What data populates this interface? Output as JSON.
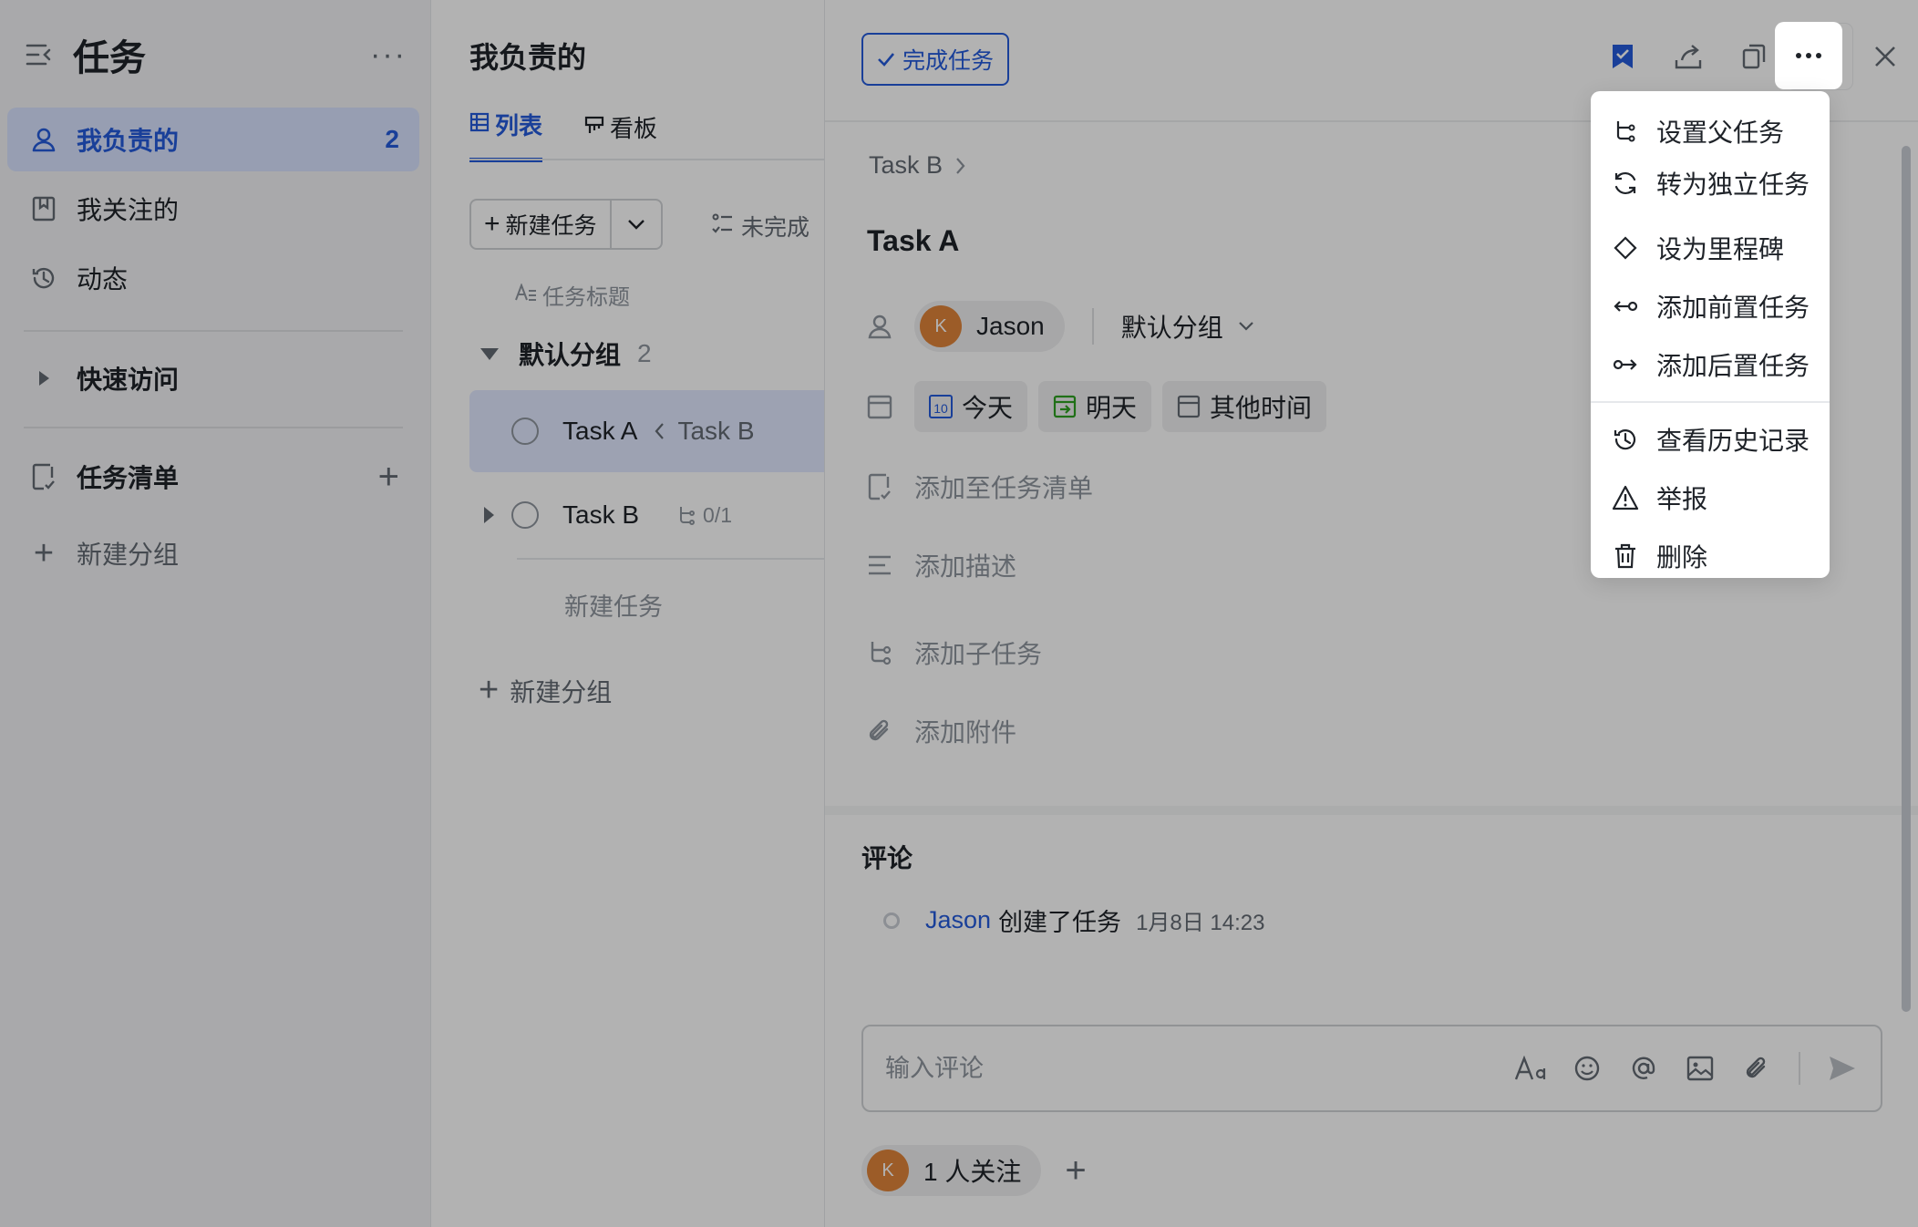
{
  "sidebar": {
    "title": "任务",
    "items": [
      {
        "label": "我负责的",
        "count": "2"
      },
      {
        "label": "我关注的"
      },
      {
        "label": "动态"
      }
    ],
    "quick_access": "快速访问",
    "task_lists": "任务清单",
    "new_group": "新建分组"
  },
  "list": {
    "title": "我负责的",
    "tabs": [
      {
        "label": "列表"
      },
      {
        "label": "看板"
      }
    ],
    "new_task": "新建任务",
    "filter": "未完成",
    "column": "任务标题",
    "group": {
      "name": "默认分组",
      "count": "2"
    },
    "tasks": [
      {
        "title": "Task A",
        "parent": "Task B"
      },
      {
        "title": "Task B",
        "subtasks": "0/1"
      }
    ],
    "inline_new_task": "新建任务",
    "new_group": "新建分组"
  },
  "detail": {
    "complete_button": "完成任务",
    "breadcrumb": "Task B",
    "title": "Task A",
    "assignee": {
      "name": "Jason",
      "initial": "K"
    },
    "group": "默认分组",
    "dates": {
      "today": "今天",
      "today_num": "10",
      "tomorrow": "明天",
      "other": "其他时间"
    },
    "add_to_list": "添加至任务清单",
    "add_description": "添加描述",
    "add_subtask": "添加子任务",
    "add_attachment": "添加附件",
    "comments_title": "评论",
    "activity": {
      "user": "Jason",
      "action": "创建了任务",
      "time": "1月8日 14:23"
    },
    "comment_placeholder": "输入评论",
    "followers": {
      "initial": "K",
      "label": "1 人关注"
    }
  },
  "menu": {
    "items": [
      {
        "label": "设置父任务",
        "icon": "parent-task-icon"
      },
      {
        "label": "转为独立任务",
        "icon": "convert-icon"
      },
      {
        "label": "设为里程碑",
        "icon": "milestone-icon"
      },
      {
        "label": "添加前置任务",
        "icon": "predecessor-icon"
      },
      {
        "label": "添加后置任务",
        "icon": "successor-icon"
      },
      {
        "label": "查看历史记录",
        "icon": "history-icon"
      },
      {
        "label": "举报",
        "icon": "report-icon"
      },
      {
        "label": "删除",
        "icon": "delete-icon"
      }
    ]
  },
  "colors": {
    "accent": "#245bdb",
    "avatar": "#e0853a",
    "overlay": "rgba(0,0,0,0.3)"
  }
}
